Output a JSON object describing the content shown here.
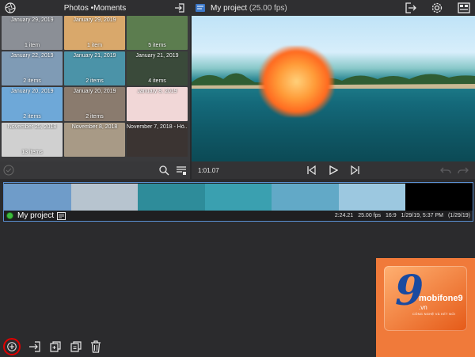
{
  "browser": {
    "title": "Photos •Moments",
    "tiles": [
      {
        "date": "January 29, 2019",
        "count": "1 item",
        "color": "#8b8f96"
      },
      {
        "date": "January 29, 2019",
        "count": "1 item",
        "color": "#d9a86b"
      },
      {
        "date": "",
        "count": "5 items",
        "color": "#5c7d4f"
      },
      {
        "date": "January 22, 2019",
        "count": "2 items",
        "color": "#7f9bb5"
      },
      {
        "date": "January 21, 2019",
        "count": "2 items",
        "color": "#4b93a8"
      },
      {
        "date": "January 21, 2019",
        "count": "4 items",
        "color": "#3a4a3a"
      },
      {
        "date": "January 20, 2019",
        "count": "2 items",
        "color": "#6ea8d8"
      },
      {
        "date": "January 20, 2019",
        "count": "2 items",
        "color": "#8a7b6e"
      },
      {
        "date": "January 8, 2019",
        "count": "",
        "color": "#f1d7d7"
      },
      {
        "date": "November 25, 2018",
        "count": "13 items",
        "color": "#d0d0d0"
      },
      {
        "date": "November 8, 2018",
        "count": "",
        "color": "#a89a86"
      },
      {
        "date": "November 7, 2018 - Hồ...",
        "count": "",
        "color": "#3b3432"
      }
    ]
  },
  "preview": {
    "project_title": "My project",
    "fps": "(25.00 fps)",
    "timecode": "1:01.07"
  },
  "timeline": {
    "project_name": "My project",
    "duration": "2:24.21",
    "fps": "25.00 fps",
    "aspect": "16:9",
    "date": "1/29/19, 5:37 PM",
    "date_short": "(1/29/19)",
    "frames": [
      {
        "color": "#6f9cc9"
      },
      {
        "color": "#b7c4cf"
      },
      {
        "color": "#2e8c9a"
      },
      {
        "color": "#3aa0b0"
      },
      {
        "color": "#62a9c7"
      },
      {
        "color": "#9cc8e0"
      },
      {
        "color": "#000000"
      }
    ]
  },
  "watermark": {
    "digit": "9",
    "brand": "mobifone9",
    "tld": ".vn",
    "tagline": "CÔNG NGHỆ VÀ KẾT NỐI"
  },
  "icons": {
    "settings": "gear-icon",
    "export": "export-icon",
    "search": "search-icon",
    "play": "play-icon"
  }
}
